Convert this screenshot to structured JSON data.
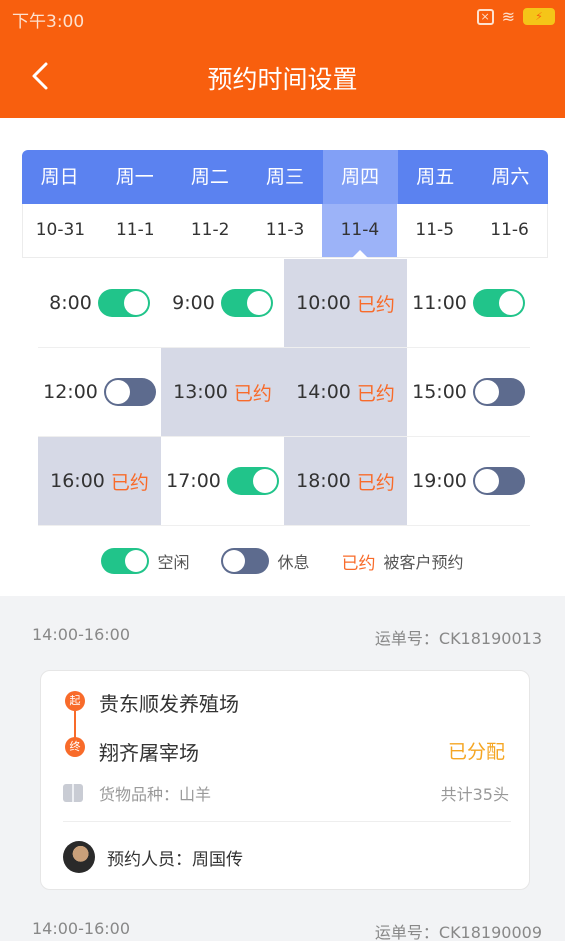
{
  "statusbar": {
    "time": "下午3:00"
  },
  "header": {
    "title": "预约时间设置"
  },
  "week": {
    "days": [
      {
        "weekday": "周日",
        "date": "10-31",
        "selected": false
      },
      {
        "weekday": "周一",
        "date": "11-1",
        "selected": false
      },
      {
        "weekday": "周二",
        "date": "11-2",
        "selected": false
      },
      {
        "weekday": "周三",
        "date": "11-3",
        "selected": false
      },
      {
        "weekday": "周四",
        "date": "11-4",
        "selected": true
      },
      {
        "weekday": "周五",
        "date": "11-5",
        "selected": false
      },
      {
        "weekday": "周六",
        "date": "11-6",
        "selected": false
      }
    ]
  },
  "slots": [
    {
      "time": "8:00",
      "state": "free"
    },
    {
      "time": "9:00",
      "state": "free"
    },
    {
      "time": "10:00",
      "state": "booked"
    },
    {
      "time": "11:00",
      "state": "free"
    },
    {
      "time": "12:00",
      "state": "rest"
    },
    {
      "time": "13:00",
      "state": "booked"
    },
    {
      "time": "14:00",
      "state": "booked"
    },
    {
      "time": "15:00",
      "state": "rest"
    },
    {
      "time": "16:00",
      "state": "booked"
    },
    {
      "time": "17:00",
      "state": "free"
    },
    {
      "time": "18:00",
      "state": "booked"
    },
    {
      "time": "19:00",
      "state": "rest"
    }
  ],
  "booked_label": "已约",
  "legend": {
    "free": "空闲",
    "rest": "休息",
    "booked": "已约",
    "booked_desc": "被客户预约"
  },
  "orders": [
    {
      "time_range": "14:00-16:00",
      "waybill": "运单号：CK18190013",
      "start_mark": "起",
      "end_mark": "终",
      "from": "贵东顺发养殖场",
      "to": "翔齐屠宰场",
      "status": "已分配",
      "goods": "货物品种：山羊",
      "total": "共计35头",
      "booker": "预约人员：周国传"
    },
    {
      "time_range": "14:00-16:00",
      "waybill": "运单号：CK18190009"
    }
  ],
  "colors": {
    "brand": "#f85f0e",
    "week_header": "#5b82f0",
    "toggle_on": "#21c48a",
    "toggle_off": "#5d6b8e",
    "booked_text": "#f86b2a",
    "assigned": "#f5a623"
  }
}
